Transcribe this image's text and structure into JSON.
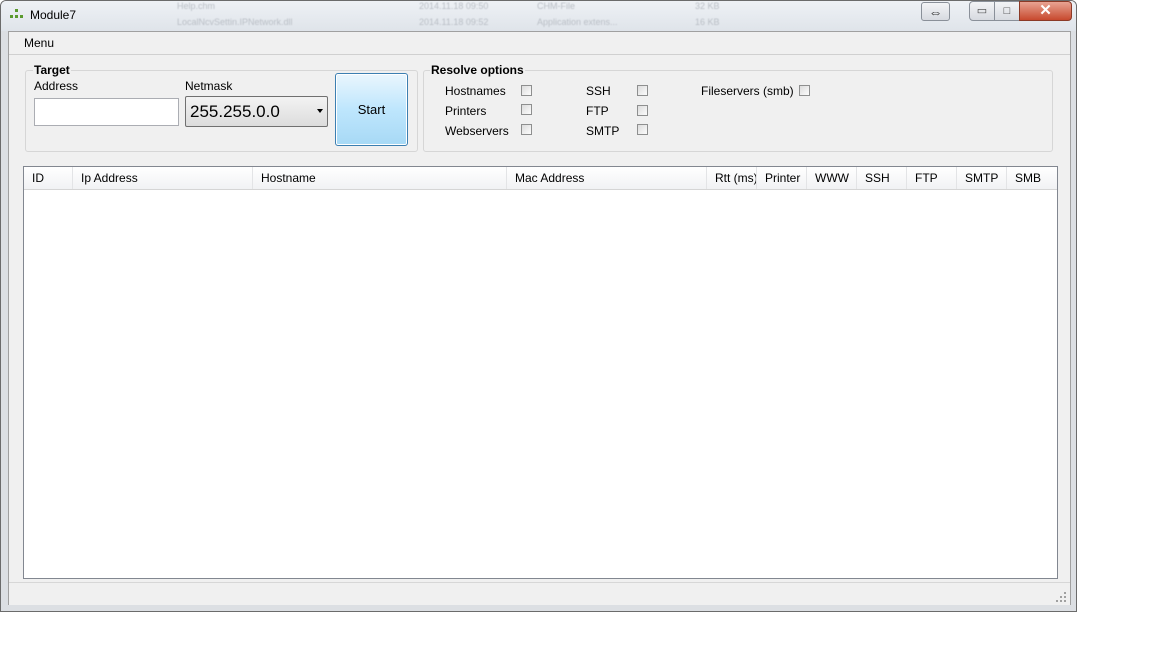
{
  "window": {
    "title": "Module7",
    "background_ghost_text": [
      "Help.chm",
      "LocalNcvSettin.IPNetwork.dll",
      "2014.11.18 09:50",
      "2014.11.18 09:52",
      "CHM-File",
      "Application extens...",
      "32 KB",
      "16 KB"
    ],
    "extra_button_glyph": "⇔",
    "minimize_glyph": "▭",
    "maximize_glyph": "□",
    "close_glyph": "✕"
  },
  "menubar": {
    "menu_label": "Menu"
  },
  "target": {
    "group_title": "Target",
    "address_label": "Address",
    "address_value": "",
    "netmask_label": "Netmask",
    "netmask_value": "255.255.0.0",
    "start_label": "Start"
  },
  "resolve": {
    "group_title": "Resolve options",
    "options": [
      {
        "label": "Hostnames",
        "checked": false
      },
      {
        "label": "Printers",
        "checked": false
      },
      {
        "label": "Webservers",
        "checked": false
      },
      {
        "label": "SSH",
        "checked": false
      },
      {
        "label": "FTP",
        "checked": false
      },
      {
        "label": "SMTP",
        "checked": false
      },
      {
        "label": "Fileservers (smb)",
        "checked": false
      }
    ]
  },
  "results": {
    "columns": [
      "ID",
      "Ip Address",
      "Hostname",
      "Mac Address",
      "Rtt (ms)",
      "Printer",
      "WWW",
      "SSH",
      "FTP",
      "SMTP",
      "SMB"
    ],
    "rows": []
  },
  "colors": {
    "accent": "#3c7fb1",
    "close": "#c7492e"
  }
}
